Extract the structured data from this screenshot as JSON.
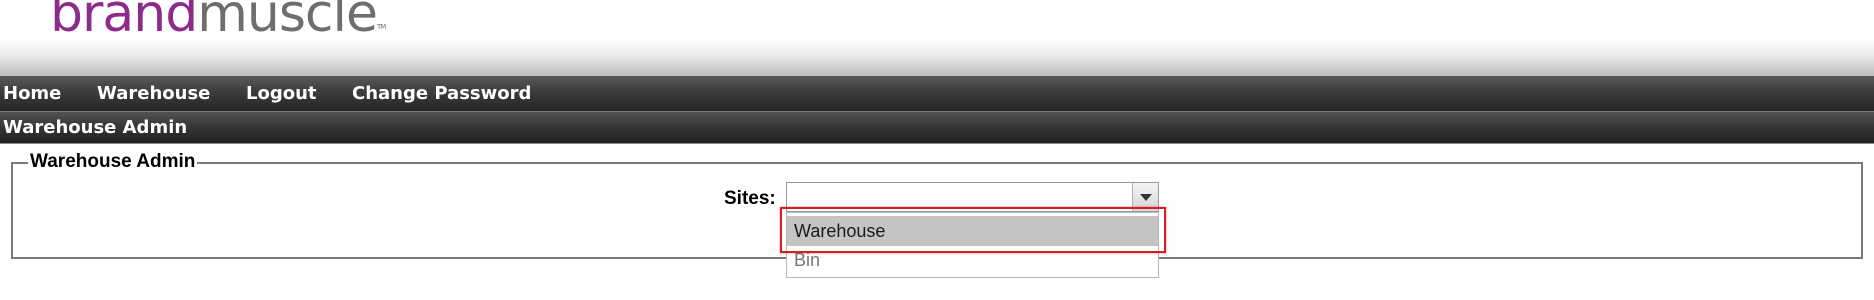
{
  "logo": {
    "brand": "brand",
    "muscle": "muscle",
    "tm": "TM",
    "brand_color": "#8d2b8d",
    "muscle_color": "#6e6e6e"
  },
  "nav": {
    "items": [
      {
        "label": "Home"
      },
      {
        "label": "Warehouse"
      },
      {
        "label": "Logout"
      },
      {
        "label": "Change Password"
      }
    ]
  },
  "page_title": "Warehouse Admin",
  "form": {
    "legend": "Warehouse Admin",
    "sites_label": "Sites:",
    "sites_value": "",
    "options": [
      {
        "label": "Warehouse",
        "selected": true
      },
      {
        "label": "Bin",
        "selected": false
      }
    ]
  },
  "colors": {
    "highlight": "#d42020",
    "option_selected_bg": "#c4c4c4"
  }
}
